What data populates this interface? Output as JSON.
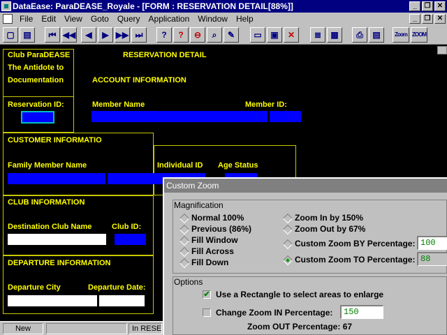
{
  "window": {
    "title": "DataEase: ParaDEASE_Royale - [FORM : RESERVATION DETAIL[88%]]",
    "buttons": [
      "_",
      "❐",
      "✕"
    ]
  },
  "menubar": {
    "items": [
      "File",
      "Edit",
      "View",
      "Goto",
      "Query",
      "Application",
      "Window",
      "Help"
    ],
    "doc_buttons": [
      "_",
      "❐",
      "✕"
    ]
  },
  "toolbar": {
    "icons": [
      "new-doc-icon",
      "open-doc-icon",
      "first-record-icon",
      "prev-page-icon",
      "prev-record-icon",
      "next-record-icon",
      "next-page-icon",
      "last-record-icon",
      "help-icon",
      "query-icon",
      "zoom-out-icon",
      "search-icon",
      "tools-icon",
      "edit-form-icon",
      "save-icon",
      "delete-icon",
      "form-view-icon",
      "table-view-icon",
      "print-icon",
      "print-preview-icon",
      "zoom-in-icon",
      "zoom-out-text-icon"
    ],
    "glyphs": [
      "▢",
      "▤",
      "⏮",
      "◀◀",
      "◀",
      "▶",
      "▶▶",
      "⏭",
      "?",
      "?",
      "⊖",
      "⌕",
      "✎",
      "▭",
      "▣",
      "✕",
      "≣",
      "▦",
      "⎙",
      "▤",
      "Zoom",
      "ZOOM"
    ]
  },
  "form": {
    "club_name": "Club ParaDEASE",
    "antidote": "The Antidote to",
    "documentation": "Documentation",
    "title": "RESERVATION DETAIL",
    "account_info": "ACCOUNT INFORMATION",
    "reservation_id": "Reservation ID:",
    "member_name": "Member Name",
    "member_id": "Member ID:",
    "customer_info": "CUSTOMER INFORMATION",
    "family_member_name": "Family Member Name",
    "individual_id": "Individual ID",
    "age_status": "Age Status",
    "club_info": "CLUB INFORMATION",
    "destination_club_name": "Destination Club Name",
    "club_id": "Club ID:",
    "departure_info": "DEPARTURE INFORMATION",
    "departure_city": "Departure City",
    "departure_date": "Departure Date:"
  },
  "statusbar": {
    "mode": "New",
    "middle": "",
    "right": "In RESE"
  },
  "dialog": {
    "title": "Custom Zoom",
    "magnification": "Magnification",
    "normal": "Normal 100%",
    "previous": "Previous (86%)",
    "fill_window": "Fill Window",
    "fill_across": "Fill Across",
    "fill_down": "Fill Down",
    "zoom_in_by": "Zoom In by   150%",
    "zoom_out_by": "Zoom Out by  67%",
    "custom_by": "Custom Zoom BY Percentage:",
    "custom_by_value": "100",
    "custom_to": "Custom Zoom TO Percentage:",
    "custom_to_value": "88",
    "options": "Options",
    "use_rectangle": "Use a Rectangle to select areas to enlarge",
    "change_zoom_in": "Change Zoom IN Percentage:",
    "change_zoom_in_value": "150",
    "zoom_out_pct": "Zoom OUT Percentage:  67",
    "checkmark": "✔",
    "use_rectangle_checked": true,
    "change_zoom_in_checked": false,
    "selected_option": "custom_to"
  },
  "colors": {
    "titlebar": "#000080",
    "form_bg": "#000000",
    "form_label": "#ffff00",
    "field_blue": "#0000ff",
    "radio_selected": "#00a000"
  }
}
